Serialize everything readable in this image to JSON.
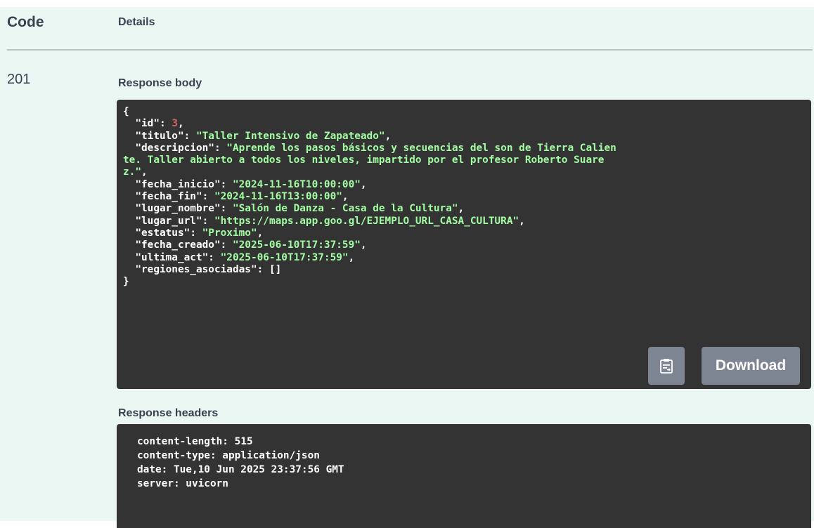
{
  "header": {
    "code_label": "Code",
    "details_label": "Details"
  },
  "response": {
    "status_code": "201",
    "body_title": "Response body",
    "body": {
      "open_brace": "{",
      "close_brace": "}",
      "lines": [
        {
          "key": "\"id\"",
          "sep": ": ",
          "value": "3",
          "type": "number",
          "tail": ","
        },
        {
          "key": "\"titulo\"",
          "sep": ": ",
          "value": "\"Taller Intensivo de Zapateado\"",
          "type": "string",
          "tail": ","
        },
        {
          "key": "\"descripcion\"",
          "sep": ": ",
          "value": "\"Aprende los pasos básicos y secuencias del son de Tierra Calien\nte. Taller abierto a todos los niveles, impartido por el profesor Roberto Suare\nz.\"",
          "type": "string",
          "tail": ","
        },
        {
          "key": "\"fecha_inicio\"",
          "sep": ": ",
          "value": "\"2024-11-16T10:00:00\"",
          "type": "string",
          "tail": ","
        },
        {
          "key": "\"fecha_fin\"",
          "sep": ": ",
          "value": "\"2024-11-16T13:00:00\"",
          "type": "string",
          "tail": ","
        },
        {
          "key": "\"lugar_nombre\"",
          "sep": ": ",
          "value": "\"Salón de Danza - Casa de la Cultura\"",
          "type": "string",
          "tail": ","
        },
        {
          "key": "\"lugar_url\"",
          "sep": ": ",
          "value": "\"https://maps.app.goo.gl/EJEMPLO_URL_CASA_CULTURA\"",
          "type": "string",
          "tail": ","
        },
        {
          "key": "\"estatus\"",
          "sep": ": ",
          "value": "\"Proximo\"",
          "type": "string",
          "tail": ","
        },
        {
          "key": "\"fecha_creado\"",
          "sep": ": ",
          "value": "\"2025-06-10T17:37:59\"",
          "type": "string",
          "tail": ","
        },
        {
          "key": "\"ultima_act\"",
          "sep": ": ",
          "value": "\"2025-06-10T17:37:59\"",
          "type": "string",
          "tail": ","
        },
        {
          "key": "\"regiones_asociadas\"",
          "sep": ": ",
          "value": "[]",
          "type": "punct",
          "tail": ""
        }
      ]
    },
    "copy_icon": "clipboard-icon",
    "download_label": "Download",
    "headers_title": "Response headers",
    "headers": [
      "content-length: 515",
      "content-type: application/json",
      "date: Tue,10 Jun 2025 23:37:56 GMT",
      "server: uvicorn"
    ]
  },
  "colors": {
    "panel_bg": "#ebf7f2",
    "code_bg": "#333333",
    "string": "#a2fca2",
    "number": "#d36363",
    "button_bg": "#7d8492",
    "text": "#3b4151"
  }
}
